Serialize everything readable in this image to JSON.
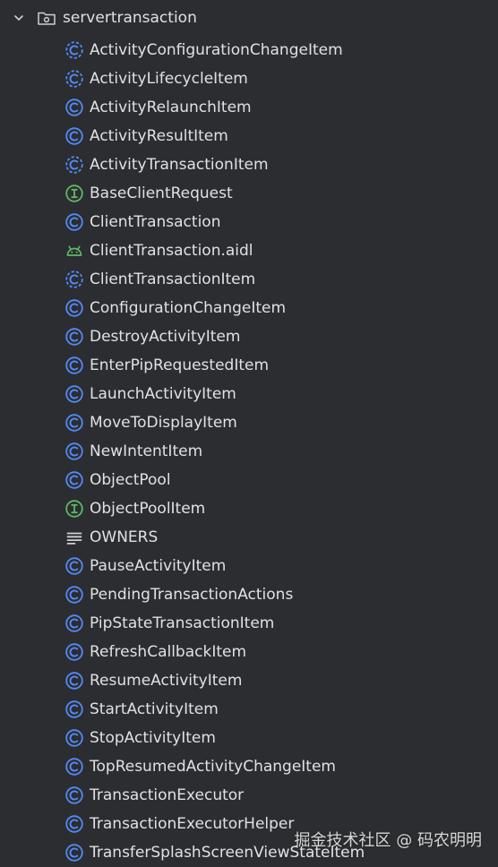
{
  "tree": {
    "folder": {
      "label": "servertransaction",
      "icon": "package-folder-icon",
      "expanded": true
    },
    "items": [
      {
        "label": "ActivityConfigurationChangeItem",
        "kind": "abstract-class"
      },
      {
        "label": "ActivityLifecycleItem",
        "kind": "abstract-class"
      },
      {
        "label": "ActivityRelaunchItem",
        "kind": "class"
      },
      {
        "label": "ActivityResultItem",
        "kind": "class"
      },
      {
        "label": "ActivityTransactionItem",
        "kind": "abstract-class"
      },
      {
        "label": "BaseClientRequest",
        "kind": "interface"
      },
      {
        "label": "ClientTransaction",
        "kind": "class"
      },
      {
        "label": "ClientTransaction.aidl",
        "kind": "android"
      },
      {
        "label": "ClientTransactionItem",
        "kind": "abstract-class"
      },
      {
        "label": "ConfigurationChangeItem",
        "kind": "class"
      },
      {
        "label": "DestroyActivityItem",
        "kind": "class"
      },
      {
        "label": "EnterPipRequestedItem",
        "kind": "class"
      },
      {
        "label": "LaunchActivityItem",
        "kind": "class"
      },
      {
        "label": "MoveToDisplayItem",
        "kind": "class"
      },
      {
        "label": "NewIntentItem",
        "kind": "class"
      },
      {
        "label": "ObjectPool",
        "kind": "class"
      },
      {
        "label": "ObjectPoolItem",
        "kind": "interface"
      },
      {
        "label": "OWNERS",
        "kind": "text"
      },
      {
        "label": "PauseActivityItem",
        "kind": "class"
      },
      {
        "label": "PendingTransactionActions",
        "kind": "class"
      },
      {
        "label": "PipStateTransactionItem",
        "kind": "class"
      },
      {
        "label": "RefreshCallbackItem",
        "kind": "class"
      },
      {
        "label": "ResumeActivityItem",
        "kind": "class"
      },
      {
        "label": "StartActivityItem",
        "kind": "class"
      },
      {
        "label": "StopActivityItem",
        "kind": "class"
      },
      {
        "label": "TopResumedActivityChangeItem",
        "kind": "class"
      },
      {
        "label": "TransactionExecutor",
        "kind": "class"
      },
      {
        "label": "TransactionExecutorHelper",
        "kind": "class"
      },
      {
        "label": "TransferSplashScreenViewStateItem",
        "kind": "class"
      }
    ]
  },
  "watermark": "掘金技术社区 @ 码农明明",
  "colors": {
    "background": "#2b2d30",
    "text": "#dfe1e5",
    "class": "#548af7",
    "interface": "#5fb865",
    "android": "#5fb865",
    "textIcon": "#ced0d6",
    "chevron": "#ced0d6"
  }
}
